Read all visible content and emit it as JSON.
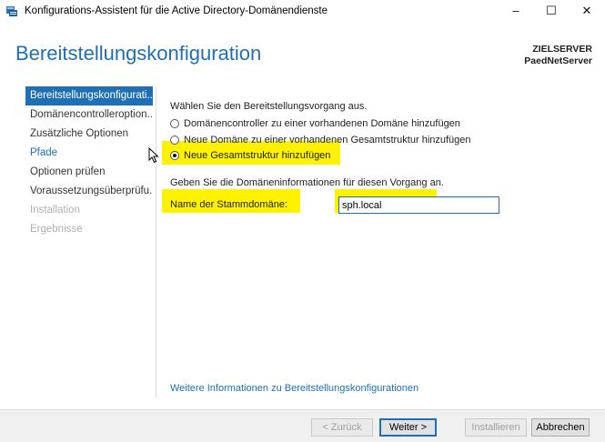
{
  "window": {
    "title": "Konfigurations-Assistent für die Active Directory-Domänendienste",
    "minimize": "–",
    "maximize": "☐",
    "close": "✕"
  },
  "header": {
    "title": "Bereitstellungskonfiguration",
    "target_label": "ZIELSERVER",
    "target_server": "PaedNetServer"
  },
  "nav": {
    "items": [
      {
        "label": "Bereitstellungskonfigurati...",
        "state": "active"
      },
      {
        "label": "Domänencontrolleroption...",
        "state": "normal"
      },
      {
        "label": "Zusätzliche Optionen",
        "state": "normal"
      },
      {
        "label": "Pfade",
        "state": "link"
      },
      {
        "label": "Optionen prüfen",
        "state": "normal"
      },
      {
        "label": "Voraussetzungsüberprüfu...",
        "state": "normal"
      },
      {
        "label": "Installation",
        "state": "disabled"
      },
      {
        "label": "Ergebnisse",
        "state": "disabled"
      }
    ]
  },
  "main": {
    "prompt": "Wählen Sie den Bereitstellungsvorgang aus.",
    "options": [
      {
        "label": "Domänencontroller zu einer vorhandenen Domäne hinzufügen",
        "checked": false
      },
      {
        "label": "Neue Domäne zu einer vorhandenen Gesamtstruktur hinzufügen",
        "checked": false
      },
      {
        "label": "Neue Gesamtstruktur hinzufügen",
        "checked": true
      }
    ],
    "domain_info": "Geben Sie die Domäneninformationen für diesen Vorgang an.",
    "root_domain_label": "Name der Stammdomäne:",
    "root_domain_value": "sph.local",
    "more_info_link": "Weitere Informationen zu Bereitstellungskonfigurationen"
  },
  "footer": {
    "back": "< Zurück",
    "next": "Weiter >",
    "install": "Installieren",
    "cancel": "Abbrechen"
  },
  "colors": {
    "accent": "#1f6fb4",
    "highlight": "#fff200"
  },
  "icons": [
    "server-manager-icon",
    "mouse-cursor-icon"
  ]
}
